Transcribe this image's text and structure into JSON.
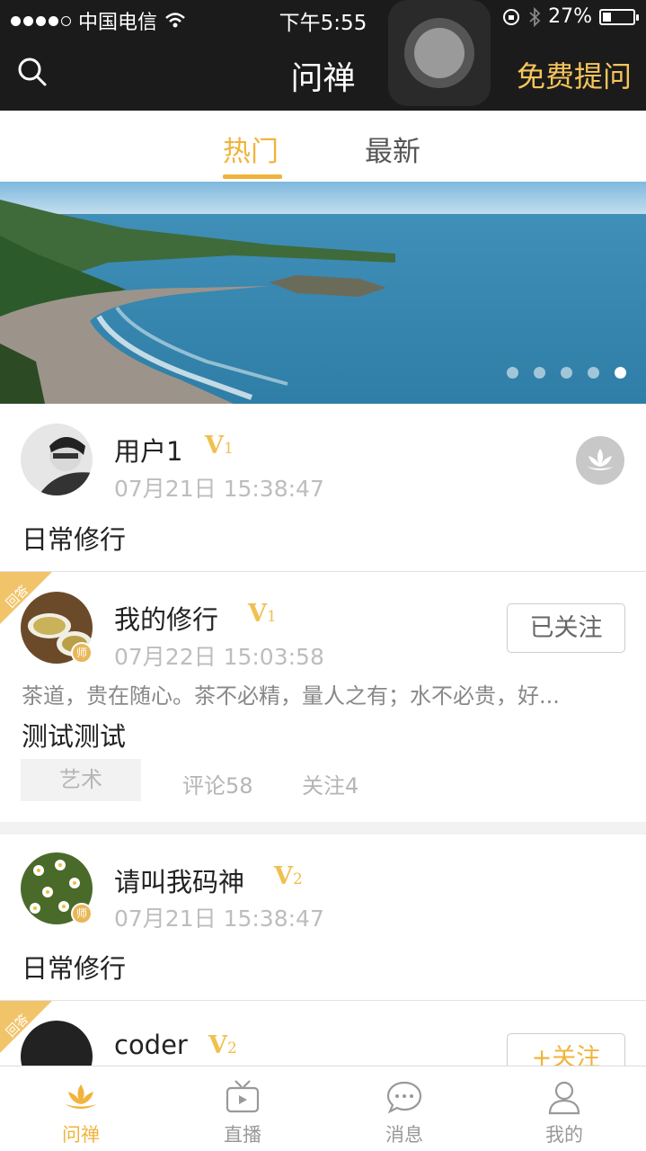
{
  "status_bar": {
    "carrier": "中国电信",
    "time": "下午5:55",
    "battery": "27%",
    "battery_level": 0.27
  },
  "nav": {
    "title": "问禅",
    "ask_label": "免费提问"
  },
  "tabs": [
    {
      "label": "热门",
      "active": true
    },
    {
      "label": "最新",
      "active": false
    }
  ],
  "banner": {
    "slide_count": 5,
    "active_index": 4
  },
  "posts": [
    {
      "user": "用户1",
      "level_letter": "V",
      "level_num": "1",
      "time": "07月21日 15:38:47",
      "title": "日常修行"
    },
    {
      "ribbon": "回答",
      "user": "我的修行",
      "level_letter": "V",
      "level_num": "1",
      "teacher_badge": "师",
      "time": "07月22日 15:03:58",
      "follow_label": "已关注",
      "excerpt": "茶道，贵在随心。茶不必精，量人之有；水不必贵，好...",
      "title": "测试测试",
      "tag": "艺术",
      "comments": "评论58",
      "follows": "关注4"
    },
    {
      "user": "请叫我码神",
      "level_letter": "V",
      "level_num": "2",
      "teacher_badge": "师",
      "time": "07月21日 15:38:47",
      "title": "日常修行"
    },
    {
      "ribbon": "回答",
      "user": "coder",
      "level_letter": "V",
      "level_num": "2",
      "follow_label": "+关注"
    }
  ],
  "tabbar": [
    {
      "label": "问禅",
      "icon": "lotus-icon",
      "active": true
    },
    {
      "label": "直播",
      "icon": "tv-icon",
      "active": false
    },
    {
      "label": "消息",
      "icon": "chat-icon",
      "active": false
    },
    {
      "label": "我的",
      "icon": "person-icon",
      "active": false
    }
  ],
  "colors": {
    "accent": "#f0b43c",
    "header_bg": "#1b1b1b",
    "ask_text": "#f6c55a"
  }
}
